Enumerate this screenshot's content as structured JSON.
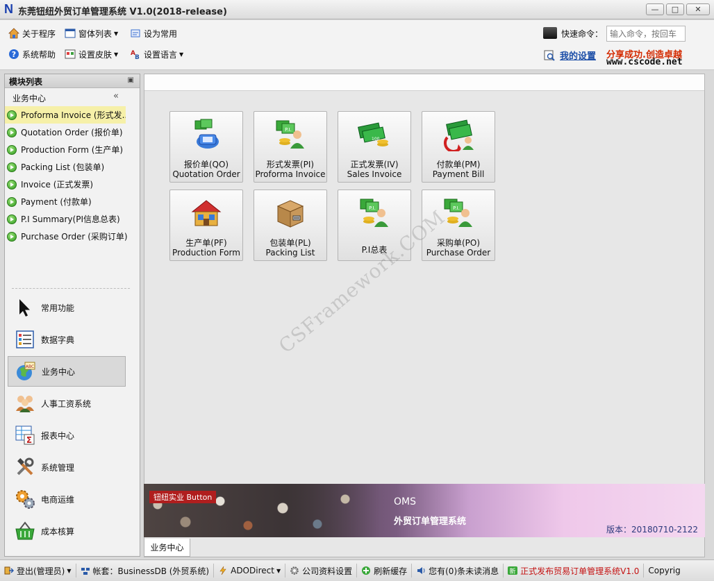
{
  "window": {
    "title": "东莞钮纽外贸订单管理系统 V1.0(2018-release)",
    "logo_letter": "N",
    "controls": [
      "—",
      "□",
      "✕"
    ]
  },
  "toolbar": {
    "row1": [
      {
        "label": "关于程序",
        "icon": "home-icon"
      },
      {
        "label": "窗体列表",
        "icon": "window-list-icon",
        "dropdown": true
      },
      {
        "label": "设为常用",
        "icon": "set-favorite-icon"
      }
    ],
    "row2": [
      {
        "label": "系统帮助",
        "icon": "help-icon"
      },
      {
        "label": "设置皮肤",
        "icon": "skin-icon",
        "dropdown": true
      },
      {
        "label": "设置语言",
        "icon": "language-icon",
        "dropdown": true
      }
    ],
    "quick_command_label": "快速命令：",
    "quick_command_placeholder": "输入命令，按回车",
    "my_settings": "我的设置",
    "brand_slogan": "分享成功.创造卓越",
    "brand_site": "www.cscode.net"
  },
  "left_panel": {
    "header": "模块列表",
    "pin": "▣",
    "group_title": "业务中心",
    "collapse": "«",
    "modules": [
      {
        "label": "Proforma Invoice (形式发..."
      },
      {
        "label": "Quotation Order (报价单)"
      },
      {
        "label": "Production Form (生产单)"
      },
      {
        "label": "Packing List (包装单)"
      },
      {
        "label": "Invoice (正式发票)"
      },
      {
        "label": "Payment (付款单)"
      },
      {
        "label": "P.I Summary(PI信息总表)"
      },
      {
        "label": "Purchase Order (采购订单)"
      }
    ],
    "nav": [
      {
        "label": "常用功能",
        "icon": "cursor-arrow-icon"
      },
      {
        "label": "数据字典",
        "icon": "dictionary-list-icon"
      },
      {
        "label": "业务中心",
        "icon": "globe-abc-icon"
      },
      {
        "label": "人事工资系统",
        "icon": "people-group-icon"
      },
      {
        "label": "报表中心",
        "icon": "report-sigma-icon"
      },
      {
        "label": "系统管理",
        "icon": "tools-icon"
      },
      {
        "label": "电商运维",
        "icon": "gears-icon"
      },
      {
        "label": "成本核算",
        "icon": "basket-icon"
      }
    ]
  },
  "tiles": [
    {
      "line1": "报价单(QO)",
      "line2": "Quotation Order",
      "icon": "quotation-phone-icon"
    },
    {
      "line1": "形式发票(PI)",
      "line2": "Proforma Invoice",
      "icon": "pi-user-coins-icon"
    },
    {
      "line1": "正式发票(IV)",
      "line2": "Sales Invoice",
      "icon": "banknotes-coins-icon"
    },
    {
      "line1": "付款单(PM)",
      "line2": "Payment Bill",
      "icon": "banknotes-refresh-icon"
    },
    {
      "line1": "生产单(PF)",
      "line2": "Production Form",
      "icon": "factory-house-icon"
    },
    {
      "line1": "包装单(PL)",
      "line2": "Packing List",
      "icon": "cardboard-box-icon"
    },
    {
      "line1": "P.I总表",
      "line2": "",
      "icon": "pi-user-coins-icon"
    },
    {
      "line1": "采购单(PO)",
      "line2": "Purchase Order",
      "icon": "pi-user-coins-icon"
    }
  ],
  "watermark": "CSFramework.COM",
  "banner": {
    "tag": "钮纽实业 Button",
    "oms": "OMS",
    "system_name": "外贸订单管理系统",
    "version": "版本：20180710-2122"
  },
  "doc_tab": "业务中心",
  "statusbar": [
    {
      "label": "登出(管理员)",
      "icon": "logout-icon",
      "dropdown": true
    },
    {
      "label": "帐套：BusinessDB (外贸系统)",
      "icon": "database-icon"
    },
    {
      "label": "ADODirect",
      "icon": "lightning-icon",
      "dropdown": true
    },
    {
      "label": "公司资料设置",
      "icon": "settings-gear-icon"
    },
    {
      "label": "刷新缓存",
      "icon": "refresh-plus-icon"
    },
    {
      "label": "您有(0)条未读消息",
      "icon": "speaker-icon"
    },
    {
      "label": "正式发布贸易订单管理系统V1.0",
      "icon": "new-badge-icon",
      "release": true
    },
    {
      "label": "Copyrig",
      "icon": ""
    }
  ],
  "colors": {
    "accent_link": "#1d4fa8",
    "brand_red": "#d42a00",
    "active_module": "#f6f0a8",
    "release_text": "#c41010"
  }
}
